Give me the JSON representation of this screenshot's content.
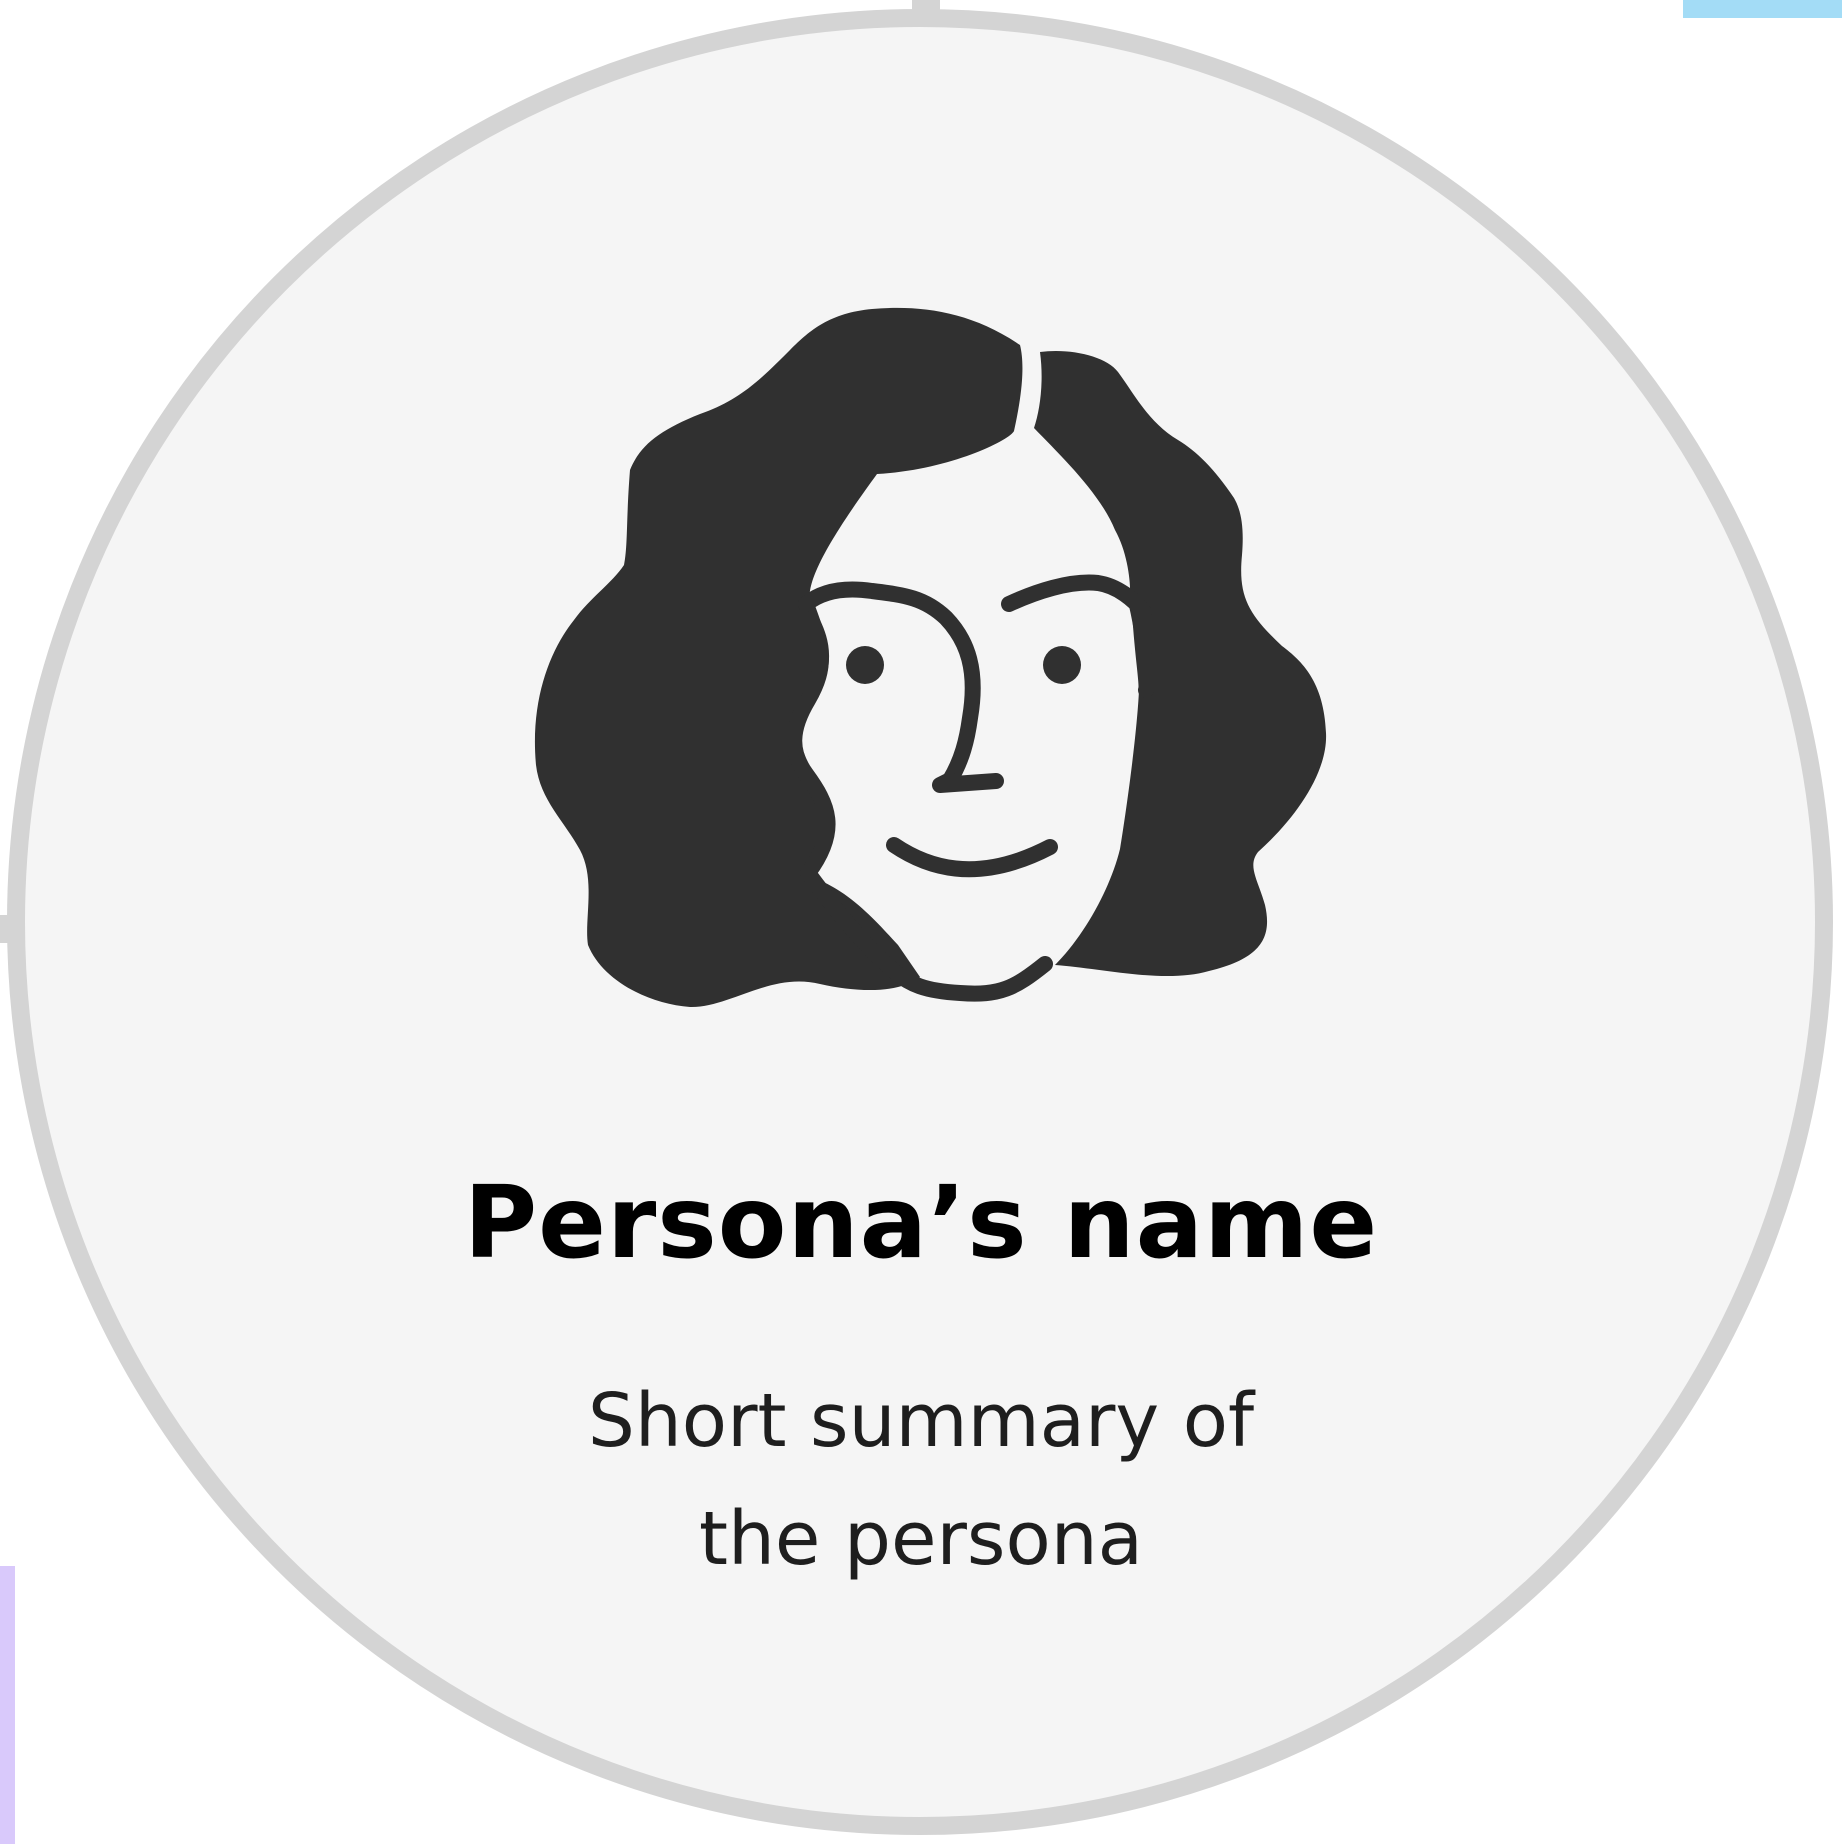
{
  "persona": {
    "name": "Persona’s name",
    "summary": "Short summary of the persona",
    "avatar_icon": "woman-face-icon"
  },
  "colors": {
    "circle_fill": "#f5f5f5",
    "circle_border": "#d4d4d4",
    "icon": "#303030",
    "accent_blue": "#a3dcf6",
    "accent_purple": "#d9c9fb"
  }
}
